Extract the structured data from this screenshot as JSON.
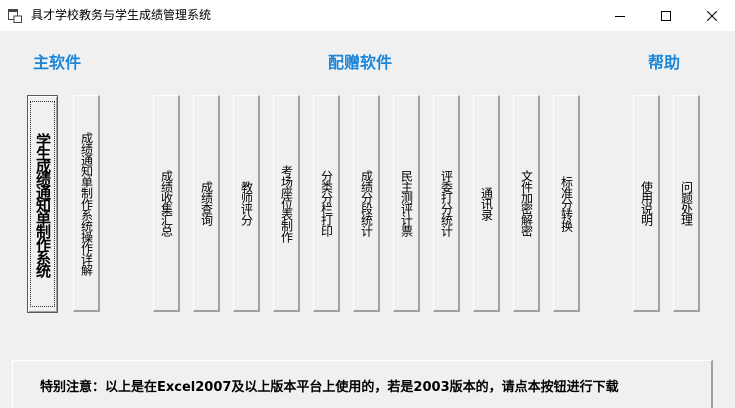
{
  "window": {
    "title": "具才学校教务与学生成绩管理系统",
    "controls": {
      "minimize": "—",
      "maximize": "☐",
      "close": "✕"
    }
  },
  "sections": {
    "main": "主软件",
    "bonus": "配赠软件",
    "help": "帮助"
  },
  "buttons": {
    "main_system": "学生成绩通知单制作系统",
    "main_guide": "成绩通知单制作系统操作详解",
    "score_summary": "成绩收集汇总",
    "score_query": "成绩查询",
    "teacher_score": "教师评分",
    "exam_seating": "考场座位表制作",
    "class_print": "分类分栏打印",
    "score_stats": "成绩分段统计",
    "democratic_vote": "民主测评计票",
    "judge_stats": "评委打分统计",
    "contacts": "通讯录",
    "file_encrypt": "文件加密解密",
    "standard_score": "标准分转换",
    "usage_guide": "使用说明",
    "faq": "问题处理"
  },
  "notice": "特别注意：以上是在Excel2007及以上版本平台上使用的，若是2003版本的，请点本按钮进行下载"
}
